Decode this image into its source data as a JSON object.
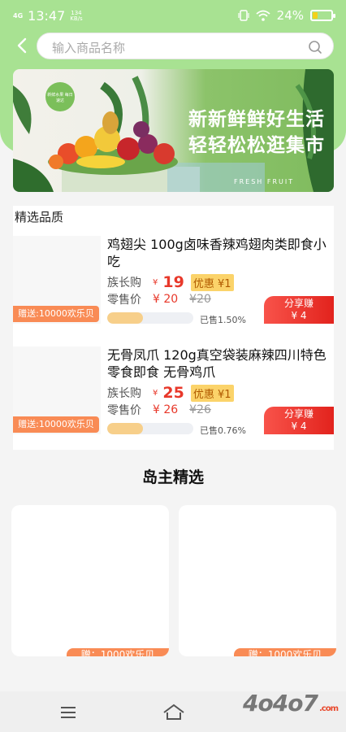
{
  "status_bar": {
    "network": "4G",
    "time": "13:47",
    "speed": "134",
    "speed_unit": "KB/s",
    "battery": "24%",
    "battery_level": 0.24
  },
  "search": {
    "placeholder": "输入商品名称"
  },
  "banner": {
    "headline_1": "新新鲜鲜好生活",
    "headline_2": "轻轻松松逛集市",
    "fresh_text": "FRESH FRUIT",
    "tag_text": "新鲜水果 每日速达"
  },
  "featured": {
    "title": "精选品质",
    "items": [
      {
        "name": "鸡翅尖 100g卤味香辣鸡翅肉类即食小吃",
        "member_label": "族长购",
        "member_price": "19",
        "discount": "优惠 ¥1",
        "retail_label": "零售价",
        "retail_price": "¥ 20",
        "original_price": "¥20",
        "sold": "已售1.50%",
        "sold_fraction": 0.015,
        "gift": "赠送:10000欢乐贝",
        "share_label": "分享赚",
        "share_amount": "¥ 4"
      },
      {
        "name": "无骨凤爪 120g真空袋装麻辣四川特色零食即食 无骨鸡爪",
        "member_label": "族长购",
        "member_price": "25",
        "discount": "优惠 ¥1",
        "retail_label": "零售价",
        "retail_price": "¥ 26",
        "original_price": "¥26",
        "sold": "已售0.76%",
        "sold_fraction": 0.0076,
        "gift": "赠送:10000欢乐贝",
        "share_label": "分享赚",
        "share_amount": "¥ 4"
      }
    ],
    "yen_symbol": "¥"
  },
  "island": {
    "title": "岛主精选",
    "cards": [
      {
        "gift": "赠：1000欢乐贝"
      },
      {
        "gift": "赠：1000欢乐贝"
      }
    ]
  },
  "watermark": {
    "text": "4o4o7",
    "suffix": ".com"
  },
  "colors": {
    "header": "#a8e292",
    "accent_red": "#e8382a",
    "gift_orange": "#f98b55"
  }
}
